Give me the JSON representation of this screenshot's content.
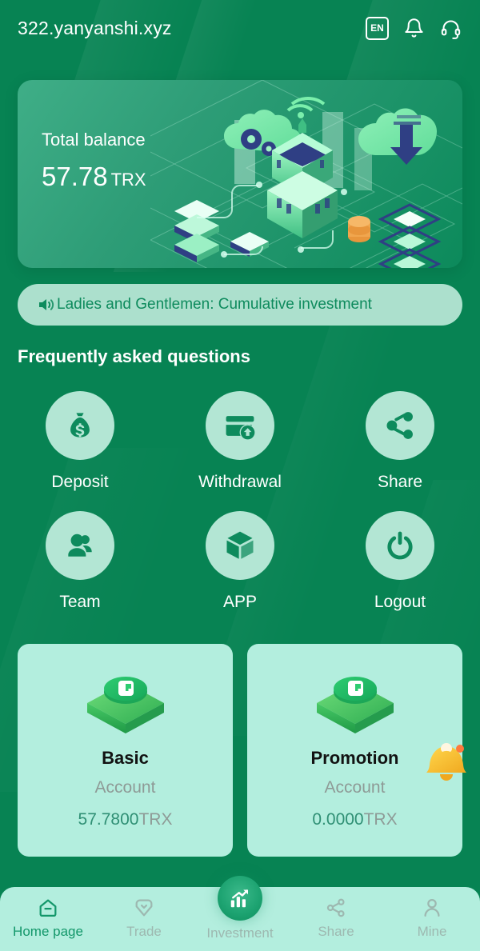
{
  "theme": {
    "bg_green": "#078353",
    "mint": "#b3eede",
    "notice_bg": "#ace0cd",
    "accent_green": "#0e8b5d",
    "inactive_gray": "#9db8b0"
  },
  "header": {
    "site_title": "322.yanyanshi.xyz",
    "lang_badge": "EN",
    "icons": [
      {
        "name": "language-badge",
        "label": "EN"
      },
      {
        "name": "bell-icon",
        "label": "Notifications"
      },
      {
        "name": "headset-icon",
        "label": "Support"
      }
    ]
  },
  "balance_card": {
    "label": "Total balance",
    "amount": "57.78",
    "currency": "TRX",
    "illustration": "blockchain-isometric-illustration"
  },
  "notice": {
    "icon": "speaker-icon",
    "text": "Ladies and Gentlemen: Cumulative investment "
  },
  "faq": {
    "title": "Frequently asked questions"
  },
  "menu": {
    "items": [
      {
        "label": "Deposit",
        "icon": "money-bag-icon"
      },
      {
        "label": "Withdrawal",
        "icon": "credit-card-arrow-icon"
      },
      {
        "label": "Share",
        "icon": "share-nodes-icon"
      },
      {
        "label": "Team",
        "icon": "people-icon"
      },
      {
        "label": "APP",
        "icon": "cube-icon"
      },
      {
        "label": "Logout",
        "icon": "power-icon"
      }
    ]
  },
  "accounts": {
    "cards": [
      {
        "name": "Basic",
        "subtitle": "Account",
        "amount": "57.7800",
        "currency": "TRX",
        "icon": "green-coin-stack-icon",
        "badge": null
      },
      {
        "name": "Promotion",
        "subtitle": "Account",
        "amount": "0.0000",
        "currency": "TRX",
        "icon": "green-coin-stack-icon",
        "badge": "bell-emoji"
      }
    ]
  },
  "bottom_nav": {
    "items": [
      {
        "label": "Home page",
        "icon": "home-icon",
        "active": true
      },
      {
        "label": "Trade",
        "icon": "trade-icon",
        "active": false
      },
      {
        "label": "Investment",
        "icon": "bar-chart-icon",
        "active": false
      },
      {
        "label": "Share",
        "icon": "share-nodes-icon",
        "active": false
      },
      {
        "label": "Mine",
        "icon": "person-icon",
        "active": false
      }
    ]
  }
}
